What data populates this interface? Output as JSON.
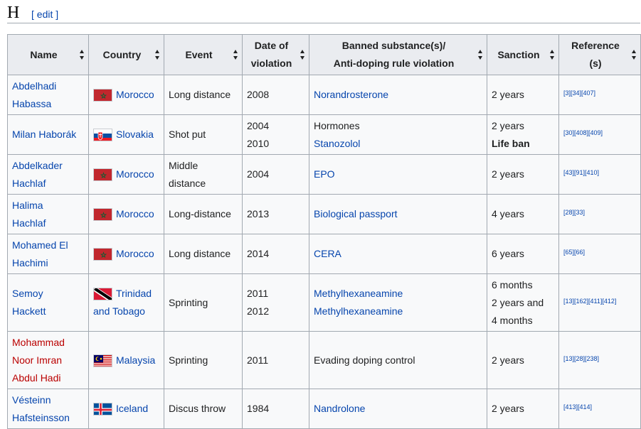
{
  "section": {
    "letter": "H",
    "edit_label": "[ edit ]"
  },
  "table": {
    "headers": {
      "name": "Name",
      "country": "Country",
      "event": "Event",
      "date_l1": "Date of",
      "date_l2": "violation",
      "subst_l1": "Banned substance(s)/",
      "subst_l2": "Anti-doping rule violation",
      "sanction": "Sanction",
      "ref_l1": "Reference",
      "ref_l2": "(s)"
    },
    "rows": [
      {
        "name_l1": "Abdelhadi",
        "name_l2": "Habassa",
        "country": "Morocco",
        "flag": "morocco-flag",
        "event_l1": "Long distance",
        "date_l1": "2008",
        "subst_l1": "Norandrosterone",
        "sanction_l1": "2 years",
        "refs": "[3][34][407]"
      },
      {
        "name_l1": "Milan Haborák",
        "country": "Slovakia",
        "flag": "slovakia-flag",
        "event_l1": "Shot put",
        "date_l1": "2004",
        "date_l2": "2010",
        "subst_l1": "Hormones",
        "subst_l2": "Stanozolol",
        "sanction_l1": "2 years",
        "sanction_l2": "Life ban",
        "refs": "[30][408][409]"
      },
      {
        "name_l1": "Abdelkader",
        "name_l2": "Hachlaf",
        "country": "Morocco",
        "flag": "morocco-flag",
        "event_l1": "Middle",
        "event_l2": "distance",
        "date_l1": "2004",
        "subst_l1": "EPO",
        "sanction_l1": "2 years",
        "refs": "[43][91][410]"
      },
      {
        "name_l1": "Halima",
        "name_l2": "Hachlaf",
        "country": "Morocco",
        "flag": "morocco-flag",
        "event_l1": "Long-distance",
        "date_l1": "2013",
        "subst_l1": "Biological passport",
        "sanction_l1": "4 years",
        "refs": "[28][33]"
      },
      {
        "name_l1": "Mohamed El",
        "name_l2": "Hachimi",
        "country": "Morocco",
        "flag": "morocco-flag",
        "event_l1": "Long distance",
        "date_l1": "2014",
        "subst_l1": "CERA",
        "sanction_l1": "6 years",
        "refs": "[65][66]"
      },
      {
        "name_l1": "Semoy",
        "name_l2": "Hackett",
        "country_l1": "Trinidad",
        "country_l2": "and Tobago",
        "flag": "trinidad-and-tobago-flag",
        "event_l1": "Sprinting",
        "date_l1": "2011",
        "date_l2": "2012",
        "subst_l1": "Methylhexaneamine",
        "subst_l2": "Methylhexaneamine",
        "sanction_l1": "6 months",
        "sanction_l2": "2 years and",
        "sanction_l3": "4 months",
        "refs": "[13][162][411][412]"
      },
      {
        "name_l1": "Mohammad",
        "name_l2": "Noor Imran",
        "name_l3": "Abdul Hadi",
        "country": "Malaysia",
        "flag": "malaysia-flag",
        "event_l1": "Sprinting",
        "date_l1": "2011",
        "subst_l1": "Evading doping control",
        "sanction_l1": "2 years",
        "refs": "[13][28][238]"
      },
      {
        "name_l1": "Vésteinn",
        "name_l2": "Hafsteinsson",
        "country": "Iceland",
        "flag": "iceland-flag",
        "event_l1": "Discus throw",
        "date_l1": "1984",
        "subst_l1": "Nandrolone",
        "sanction_l1": "2 years",
        "refs": "[413][414]"
      }
    ]
  },
  "colors": {
    "link": "#0645ad",
    "redlink": "#ba0000",
    "header_bg": "#eaecf0",
    "cell_bg": "#f8f9fa",
    "border": "#a2a9b1"
  }
}
